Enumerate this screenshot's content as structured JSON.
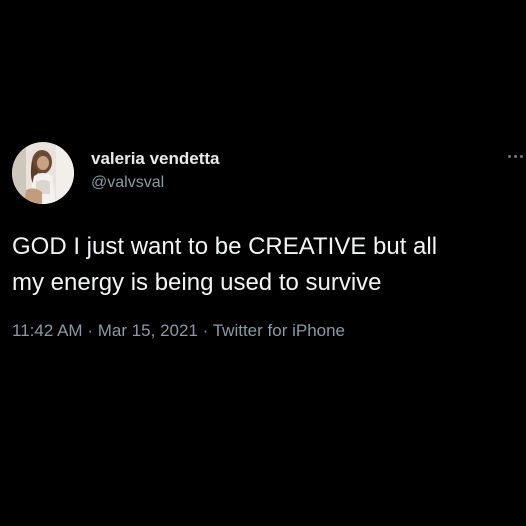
{
  "user": {
    "display_name": "valeria vendetta",
    "handle": "@valvsval",
    "avatar_icon": "profile-photo"
  },
  "tweet": {
    "text": "GOD I just want to be CREATIVE but all\nmy energy is being used to survive",
    "time": "11:42 AM",
    "separator": "·",
    "date": "Mar 15, 2021",
    "source": "Twitter for iPhone"
  },
  "menu": {
    "icon": "more-options-icon"
  },
  "colors": {
    "background": "#000000",
    "primary_text": "#e7e9ea",
    "secondary_text": "#8b98a5"
  }
}
